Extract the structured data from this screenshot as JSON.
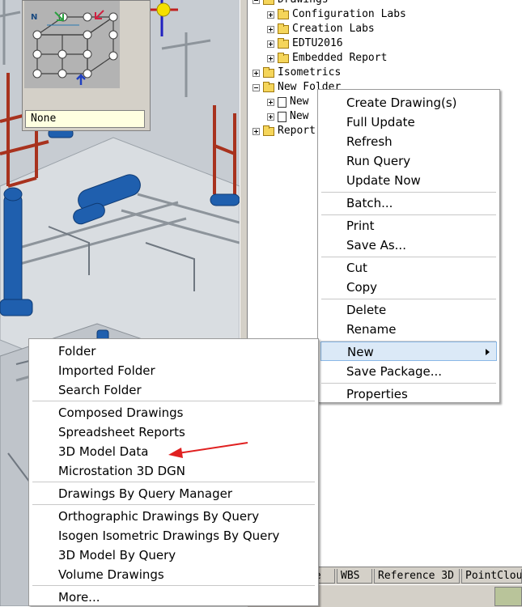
{
  "viewcube": {
    "compass_label": "N",
    "view_name": "None"
  },
  "tree": {
    "items": [
      {
        "label": "Drawings"
      },
      {
        "label": "Configuration Labs"
      },
      {
        "label": "Creation Labs"
      },
      {
        "label": "EDTU2016"
      },
      {
        "label": "Embedded Report"
      },
      {
        "label": "Isometrics"
      },
      {
        "label": "New Folder"
      },
      {
        "label": "New"
      },
      {
        "label": "New"
      },
      {
        "label": "Report"
      }
    ]
  },
  "tabs": [
    {
      "label": "ce"
    },
    {
      "label": "WBS"
    },
    {
      "label": "Reference 3D"
    },
    {
      "label": "PointClou"
    }
  ],
  "context_menu": {
    "items": [
      {
        "label": "Create Drawing(s)"
      },
      {
        "label": "Full Update"
      },
      {
        "label": "Refresh"
      },
      {
        "label": "Run Query"
      },
      {
        "label": "Update Now"
      },
      {
        "label": "Batch..."
      },
      {
        "label": "Print"
      },
      {
        "label": "Save As..."
      },
      {
        "label": "Cut"
      },
      {
        "label": "Copy"
      },
      {
        "label": "Delete"
      },
      {
        "label": "Rename"
      },
      {
        "label": "New"
      },
      {
        "label": "Save Package..."
      },
      {
        "label": "Properties"
      }
    ]
  },
  "new_submenu": {
    "items": [
      {
        "label": "Folder"
      },
      {
        "label": "Imported Folder"
      },
      {
        "label": "Search Folder"
      },
      {
        "label": "Composed Drawings"
      },
      {
        "label": "Spreadsheet Reports"
      },
      {
        "label": "3D Model Data"
      },
      {
        "label": "Microstation 3D DGN"
      },
      {
        "label": "Drawings By Query Manager"
      },
      {
        "label": "Orthographic Drawings By Query"
      },
      {
        "label": "Isogen Isometric Drawings By Query"
      },
      {
        "label": "3D Model By Query"
      },
      {
        "label": "Volume Drawings"
      },
      {
        "label": "More..."
      }
    ]
  },
  "colors": {
    "highlight": "#dbe9f7",
    "annotation_arrow": "#e02020",
    "steel_red": "#a8321e",
    "equipment_blue": "#1f5fae"
  }
}
